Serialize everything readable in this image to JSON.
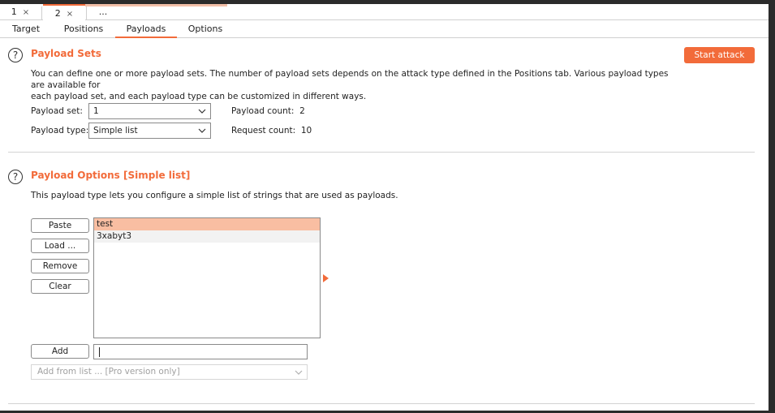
{
  "instance_tabs": [
    {
      "label": "1",
      "close": "×"
    },
    {
      "label": "2",
      "close": "×"
    },
    {
      "label": "..."
    }
  ],
  "sub_tabs": [
    "Target",
    "Positions",
    "Payloads",
    "Options"
  ],
  "active_sub_tab": "Payloads",
  "payload_sets": {
    "title": "Payload Sets",
    "description_line1": "You can define one or more payload sets. The number of payload sets depends on the attack type defined in the Positions tab. Various payload types are available for",
    "description_line2": "each payload set, and each payload type can be customized in different ways.",
    "start_attack_label": "Start attack",
    "payload_set_label": "Payload set:",
    "payload_set_value": "1",
    "payload_type_label": "Payload type:",
    "payload_type_value": "Simple list",
    "payload_count_label": "Payload count:",
    "payload_count_value": "2",
    "request_count_label": "Request count:",
    "request_count_value": "10"
  },
  "payload_options": {
    "title": "Payload Options [Simple list]",
    "description": "This payload type lets you configure a simple list of strings that are used as payloads.",
    "buttons": {
      "paste": "Paste",
      "load": "Load ...",
      "remove": "Remove",
      "clear": "Clear",
      "add": "Add"
    },
    "list_items": [
      "test",
      "3xabyt3"
    ],
    "add_input_value": "",
    "add_from_list_placeholder": "Add from list ... [Pro version only]"
  },
  "colors": {
    "accent": "#f26b3a",
    "selection": "#f9bea2"
  },
  "icons": {
    "help": "help-circle-icon",
    "dropdown": "chevron-down-icon",
    "expand": "triangle-right-icon"
  }
}
